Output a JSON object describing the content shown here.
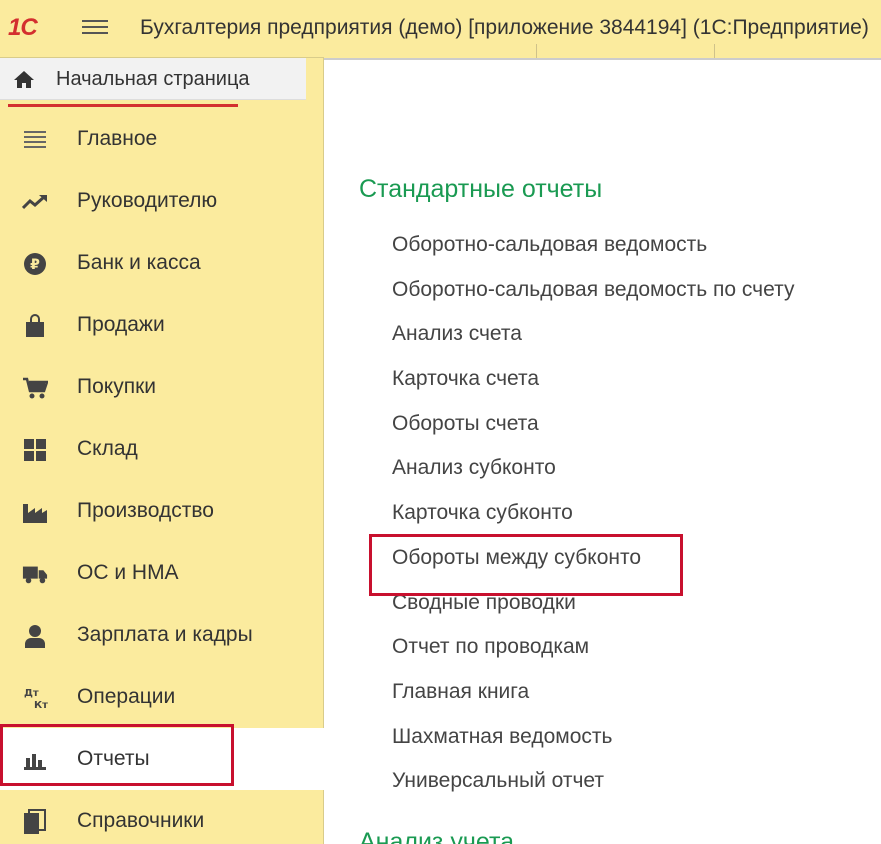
{
  "app": {
    "logo": "1С",
    "title": "Бухгалтерия предприятия (демо) [приложение 3844194]  (1С:Предприятие)"
  },
  "sidebar": {
    "home": "Начальная страница",
    "items": [
      {
        "label": "Главное",
        "icon": "menu-lines-icon"
      },
      {
        "label": "Руководителю",
        "icon": "trend-up-icon"
      },
      {
        "label": "Банк и касса",
        "icon": "ruble-coin-icon"
      },
      {
        "label": "Продажи",
        "icon": "shopping-bag-icon"
      },
      {
        "label": "Покупки",
        "icon": "cart-icon"
      },
      {
        "label": "Склад",
        "icon": "warehouse-grid-icon"
      },
      {
        "label": "Производство",
        "icon": "factory-icon"
      },
      {
        "label": "ОС и НМА",
        "icon": "truck-icon"
      },
      {
        "label": "Зарплата и кадры",
        "icon": "person-icon"
      },
      {
        "label": "Операции",
        "icon": "dt-kt-icon"
      },
      {
        "label": "Отчеты",
        "icon": "bar-chart-icon"
      },
      {
        "label": "Справочники",
        "icon": "books-icon"
      }
    ],
    "dt_kt": {
      "dt": "Дт",
      "kt": "Кт"
    }
  },
  "main": {
    "section_title": "Стандартные отчеты",
    "reports": [
      "Оборотно-сальдовая ведомость",
      "Оборотно-сальдовая ведомость по счету",
      "Анализ счета",
      "Карточка счета",
      "Обороты счета",
      "Анализ субконто",
      "Карточка субконто",
      "Обороты между субконто",
      "Сводные проводки",
      "Отчет по проводкам",
      "Главная книга",
      "Шахматная ведомость",
      "Универсальный отчет"
    ],
    "next_section": "Анализ учета"
  },
  "colors": {
    "sidebar_bg": "#fbeb9e",
    "accent_red": "#c8102e",
    "section_green": "#1a9a52"
  }
}
